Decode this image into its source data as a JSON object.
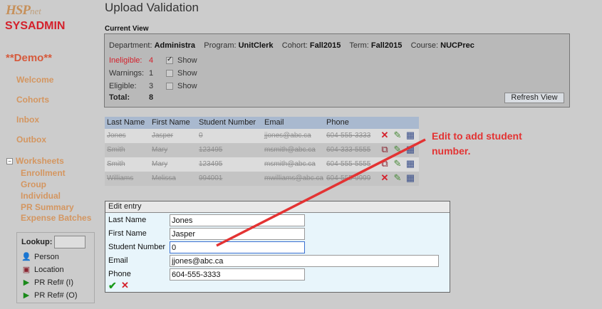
{
  "sidebar": {
    "logo_main": "HSP",
    "logo_suffix": "net",
    "role": "SYSADMIN",
    "org": "**Demo**",
    "nav": [
      "Welcome",
      "Cohorts",
      "Inbox",
      "Outbox"
    ],
    "worksheets_label": "Worksheets",
    "worksheets_toggle": "−",
    "worksheets_items": [
      "Enrollment",
      "Group",
      "Individual",
      "PR Summary",
      "Expense Batches"
    ],
    "lookup": {
      "label": "Lookup:",
      "value": "",
      "items": [
        {
          "label": "Person",
          "icon": "person-icon"
        },
        {
          "label": "Location",
          "icon": "location-icon"
        },
        {
          "label": "PR Ref# (I)",
          "icon": "play-icon"
        },
        {
          "label": "PR Ref# (O)",
          "icon": "play-icon"
        }
      ]
    }
  },
  "page": {
    "title": "Upload Validation",
    "current_view_label": "Current View"
  },
  "current_view": {
    "department_label": "Department:",
    "department": "Administra",
    "program_label": "Program:",
    "program": "UnitClerk",
    "cohort_label": "Cohort:",
    "cohort": "Fall2015",
    "term_label": "Term:",
    "term": "Fall2015",
    "course_label": "Course:",
    "course": "NUCPrec",
    "stats": [
      {
        "label": "Ineligible:",
        "count": "4",
        "show_checked": true
      },
      {
        "label": "Warnings:",
        "count": "1",
        "show_checked": false
      },
      {
        "label": "Eligible:",
        "count": "3",
        "show_checked": false
      }
    ],
    "show_label": "Show",
    "total_label": "Total:",
    "total": "8",
    "refresh_label": "Refresh View"
  },
  "table": {
    "headers": [
      "Last Name",
      "First Name",
      "Student Number",
      "Email",
      "Phone"
    ],
    "rows": [
      {
        "last": "Jones",
        "first": "Jasper",
        "num": "0",
        "email": "jjones@abc.ca",
        "phone": "604-555-3333",
        "actions": [
          "x-icon",
          "pencil-icon",
          "database-icon"
        ]
      },
      {
        "last": "Smith",
        "first": "Mary",
        "num": "123495",
        "email": "msmith@abc.ca",
        "phone": "604-333-5555",
        "actions": [
          "copy-icon",
          "pencil-icon",
          "database-icon"
        ]
      },
      {
        "last": "Smith",
        "first": "Mary",
        "num": "123495",
        "email": "msmith@abc.ca",
        "phone": "604-555-5555",
        "actions": [
          "copy-icon",
          "pencil-icon",
          "database-icon"
        ]
      },
      {
        "last": "Williams",
        "first": "Melissa",
        "num": "994001",
        "email": "mwilliams@abc.ca",
        "phone": "604-555-9999",
        "actions": [
          "x-icon",
          "pencil-icon",
          "database-icon"
        ]
      }
    ]
  },
  "edit": {
    "title": "Edit entry",
    "fields": [
      {
        "label": "Last Name",
        "value": "Jones"
      },
      {
        "label": "First Name",
        "value": "Jasper"
      },
      {
        "label": "Student Number",
        "value": "0"
      },
      {
        "label": "Email",
        "value": "jjones@abc.ca"
      },
      {
        "label": "Phone",
        "value": "604-555-3333"
      }
    ]
  },
  "annotation": {
    "line1": "Edit to add student",
    "line2": "number.",
    "color": "#e33333"
  }
}
